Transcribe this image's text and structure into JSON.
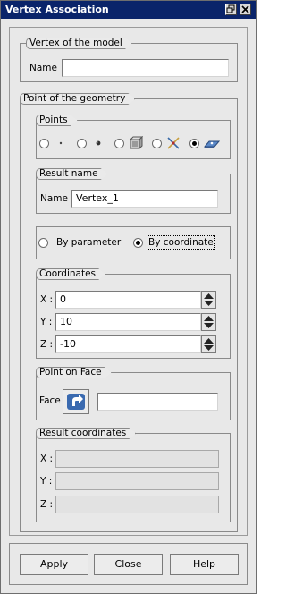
{
  "window": {
    "title": "Vertex Association"
  },
  "vertex_of_model": {
    "title": "Vertex of the model",
    "name_label": "Name",
    "name_value": ""
  },
  "point_of_geometry": {
    "title": "Point of the geometry"
  },
  "points": {
    "title": "Points",
    "options": [
      {
        "icon": "point-small-icon",
        "selected": false
      },
      {
        "icon": "point-dot-icon",
        "selected": false
      },
      {
        "icon": "cube-vertex-icon",
        "selected": false
      },
      {
        "icon": "line-intersection-icon",
        "selected": false
      },
      {
        "icon": "surface-point-icon",
        "selected": true
      }
    ]
  },
  "result_name": {
    "title": "Result name",
    "name_label": "Name",
    "name_value": "Vertex_1"
  },
  "mode": {
    "by_parameter": "By parameter",
    "by_coordinate": "By coordinate",
    "selected": "by_coordinate"
  },
  "coordinates": {
    "title": "Coordinates",
    "x_label": "X :",
    "x_value": "0",
    "y_label": "Y :",
    "y_value": "10",
    "z_label": "Z :",
    "z_value": "-10"
  },
  "point_on_face": {
    "title": "Point on Face",
    "face_label": "Face",
    "face_value": ""
  },
  "result_coordinates": {
    "title": "Result coordinates",
    "x_label": "X :",
    "x_value": "",
    "y_label": "Y :",
    "y_value": "",
    "z_label": "Z :",
    "z_value": ""
  },
  "buttons": {
    "apply": "Apply",
    "close": "Close",
    "help": "Help"
  }
}
